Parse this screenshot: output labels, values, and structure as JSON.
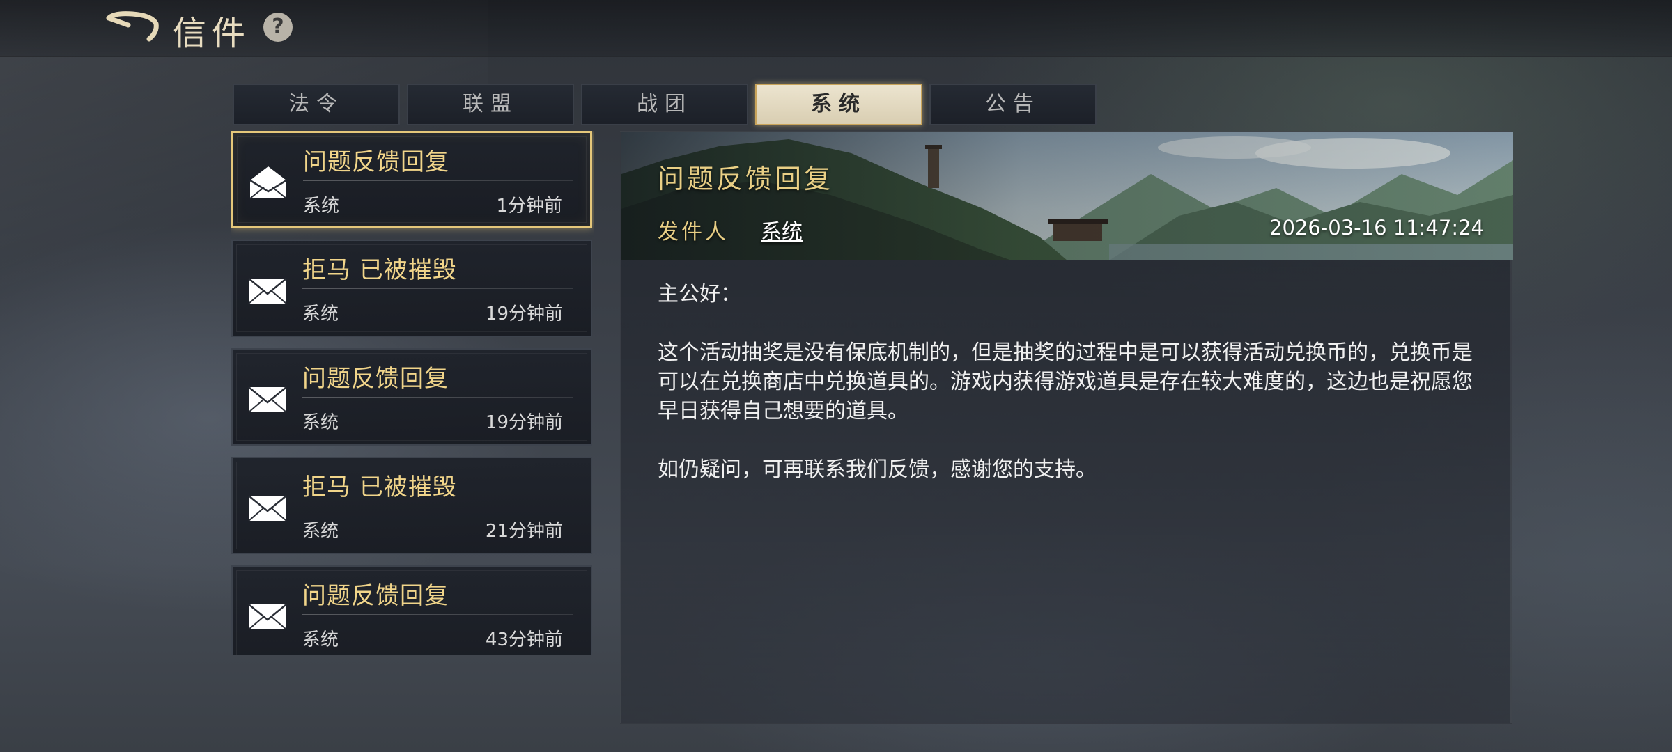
{
  "header": {
    "title": "信件",
    "help_label": "?"
  },
  "tabs": [
    {
      "label": "法令",
      "active": false
    },
    {
      "label": "联盟",
      "active": false
    },
    {
      "label": "战团",
      "active": false
    },
    {
      "label": "系统",
      "active": true
    },
    {
      "label": "公告",
      "active": false
    }
  ],
  "mail_list": [
    {
      "title": "问题反馈回复",
      "sender": "系统",
      "time": "1分钟前",
      "read": true,
      "selected": true
    },
    {
      "title": "拒马 已被摧毁",
      "sender": "系统",
      "time": "19分钟前",
      "read": false,
      "selected": false
    },
    {
      "title": "问题反馈回复",
      "sender": "系统",
      "time": "19分钟前",
      "read": false,
      "selected": false
    },
    {
      "title": "拒马 已被摧毁",
      "sender": "系统",
      "time": "21分钟前",
      "read": false,
      "selected": false
    },
    {
      "title": "问题反馈回复",
      "sender": "系统",
      "time": "43分钟前",
      "read": false,
      "selected": false
    }
  ],
  "detail": {
    "title": "问题反馈回复",
    "sender_label": "发件人",
    "sender": "系统",
    "date": "2026-03-16 11:47:24",
    "paragraphs": [
      "主公好：",
      "这个活动抽奖是没有保底机制的，但是抽奖的过程中是可以获得活动兑换币的，兑换币是可以在兑换商店中兑换道具的。游戏内获得游戏道具是存在较大难度的，这边也是祝愿您早日获得自己想要的道具。",
      "如仍疑问，可再联系我们反馈，感谢您的支持。"
    ]
  },
  "colors": {
    "accent_gold": "#f1d58a",
    "active_tab_bg": "#ece4cf",
    "selected_border": "#e5c77a"
  },
  "icons": {
    "back": "back-arrow-icon",
    "help": "question-icon",
    "mail_open": "open-envelope-icon",
    "mail_closed": "envelope-icon"
  }
}
